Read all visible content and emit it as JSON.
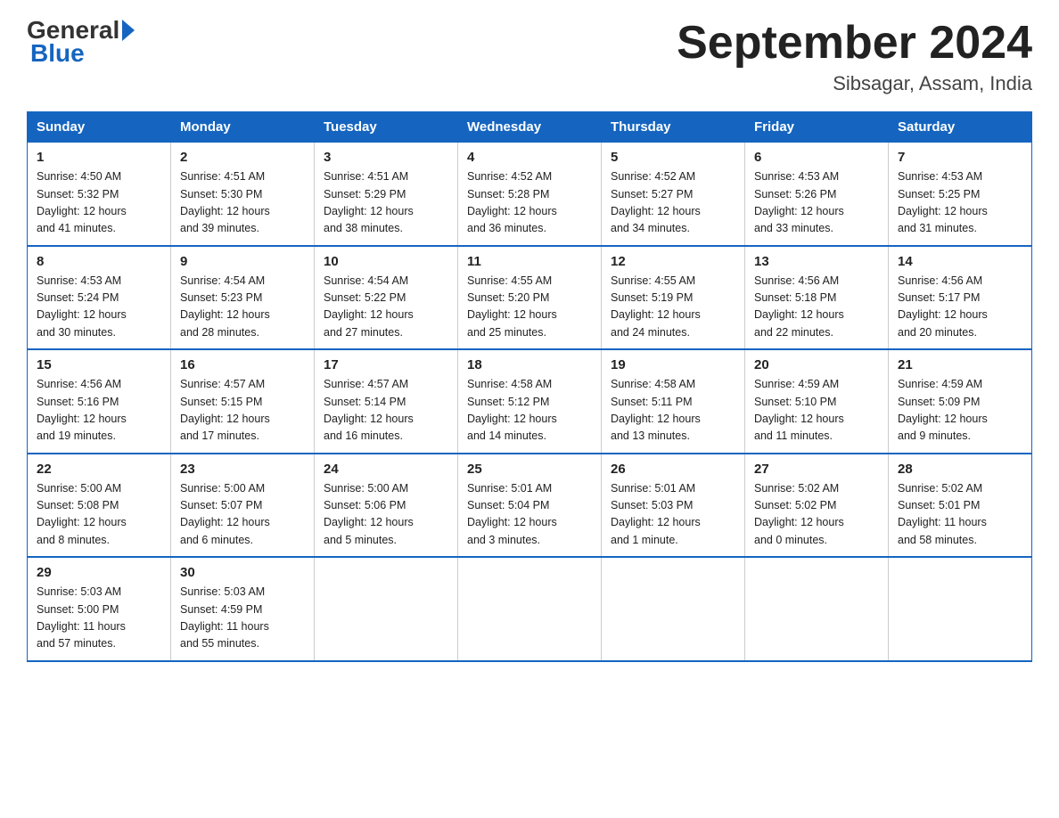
{
  "logo": {
    "general": "General",
    "blue": "Blue"
  },
  "title": "September 2024",
  "location": "Sibsagar, Assam, India",
  "days_header": [
    "Sunday",
    "Monday",
    "Tuesday",
    "Wednesday",
    "Thursday",
    "Friday",
    "Saturday"
  ],
  "weeks": [
    [
      {
        "num": "1",
        "info": "Sunrise: 4:50 AM\nSunset: 5:32 PM\nDaylight: 12 hours\nand 41 minutes."
      },
      {
        "num": "2",
        "info": "Sunrise: 4:51 AM\nSunset: 5:30 PM\nDaylight: 12 hours\nand 39 minutes."
      },
      {
        "num": "3",
        "info": "Sunrise: 4:51 AM\nSunset: 5:29 PM\nDaylight: 12 hours\nand 38 minutes."
      },
      {
        "num": "4",
        "info": "Sunrise: 4:52 AM\nSunset: 5:28 PM\nDaylight: 12 hours\nand 36 minutes."
      },
      {
        "num": "5",
        "info": "Sunrise: 4:52 AM\nSunset: 5:27 PM\nDaylight: 12 hours\nand 34 minutes."
      },
      {
        "num": "6",
        "info": "Sunrise: 4:53 AM\nSunset: 5:26 PM\nDaylight: 12 hours\nand 33 minutes."
      },
      {
        "num": "7",
        "info": "Sunrise: 4:53 AM\nSunset: 5:25 PM\nDaylight: 12 hours\nand 31 minutes."
      }
    ],
    [
      {
        "num": "8",
        "info": "Sunrise: 4:53 AM\nSunset: 5:24 PM\nDaylight: 12 hours\nand 30 minutes."
      },
      {
        "num": "9",
        "info": "Sunrise: 4:54 AM\nSunset: 5:23 PM\nDaylight: 12 hours\nand 28 minutes."
      },
      {
        "num": "10",
        "info": "Sunrise: 4:54 AM\nSunset: 5:22 PM\nDaylight: 12 hours\nand 27 minutes."
      },
      {
        "num": "11",
        "info": "Sunrise: 4:55 AM\nSunset: 5:20 PM\nDaylight: 12 hours\nand 25 minutes."
      },
      {
        "num": "12",
        "info": "Sunrise: 4:55 AM\nSunset: 5:19 PM\nDaylight: 12 hours\nand 24 minutes."
      },
      {
        "num": "13",
        "info": "Sunrise: 4:56 AM\nSunset: 5:18 PM\nDaylight: 12 hours\nand 22 minutes."
      },
      {
        "num": "14",
        "info": "Sunrise: 4:56 AM\nSunset: 5:17 PM\nDaylight: 12 hours\nand 20 minutes."
      }
    ],
    [
      {
        "num": "15",
        "info": "Sunrise: 4:56 AM\nSunset: 5:16 PM\nDaylight: 12 hours\nand 19 minutes."
      },
      {
        "num": "16",
        "info": "Sunrise: 4:57 AM\nSunset: 5:15 PM\nDaylight: 12 hours\nand 17 minutes."
      },
      {
        "num": "17",
        "info": "Sunrise: 4:57 AM\nSunset: 5:14 PM\nDaylight: 12 hours\nand 16 minutes."
      },
      {
        "num": "18",
        "info": "Sunrise: 4:58 AM\nSunset: 5:12 PM\nDaylight: 12 hours\nand 14 minutes."
      },
      {
        "num": "19",
        "info": "Sunrise: 4:58 AM\nSunset: 5:11 PM\nDaylight: 12 hours\nand 13 minutes."
      },
      {
        "num": "20",
        "info": "Sunrise: 4:59 AM\nSunset: 5:10 PM\nDaylight: 12 hours\nand 11 minutes."
      },
      {
        "num": "21",
        "info": "Sunrise: 4:59 AM\nSunset: 5:09 PM\nDaylight: 12 hours\nand 9 minutes."
      }
    ],
    [
      {
        "num": "22",
        "info": "Sunrise: 5:00 AM\nSunset: 5:08 PM\nDaylight: 12 hours\nand 8 minutes."
      },
      {
        "num": "23",
        "info": "Sunrise: 5:00 AM\nSunset: 5:07 PM\nDaylight: 12 hours\nand 6 minutes."
      },
      {
        "num": "24",
        "info": "Sunrise: 5:00 AM\nSunset: 5:06 PM\nDaylight: 12 hours\nand 5 minutes."
      },
      {
        "num": "25",
        "info": "Sunrise: 5:01 AM\nSunset: 5:04 PM\nDaylight: 12 hours\nand 3 minutes."
      },
      {
        "num": "26",
        "info": "Sunrise: 5:01 AM\nSunset: 5:03 PM\nDaylight: 12 hours\nand 1 minute."
      },
      {
        "num": "27",
        "info": "Sunrise: 5:02 AM\nSunset: 5:02 PM\nDaylight: 12 hours\nand 0 minutes."
      },
      {
        "num": "28",
        "info": "Sunrise: 5:02 AM\nSunset: 5:01 PM\nDaylight: 11 hours\nand 58 minutes."
      }
    ],
    [
      {
        "num": "29",
        "info": "Sunrise: 5:03 AM\nSunset: 5:00 PM\nDaylight: 11 hours\nand 57 minutes."
      },
      {
        "num": "30",
        "info": "Sunrise: 5:03 AM\nSunset: 4:59 PM\nDaylight: 11 hours\nand 55 minutes."
      },
      {
        "num": "",
        "info": ""
      },
      {
        "num": "",
        "info": ""
      },
      {
        "num": "",
        "info": ""
      },
      {
        "num": "",
        "info": ""
      },
      {
        "num": "",
        "info": ""
      }
    ]
  ]
}
